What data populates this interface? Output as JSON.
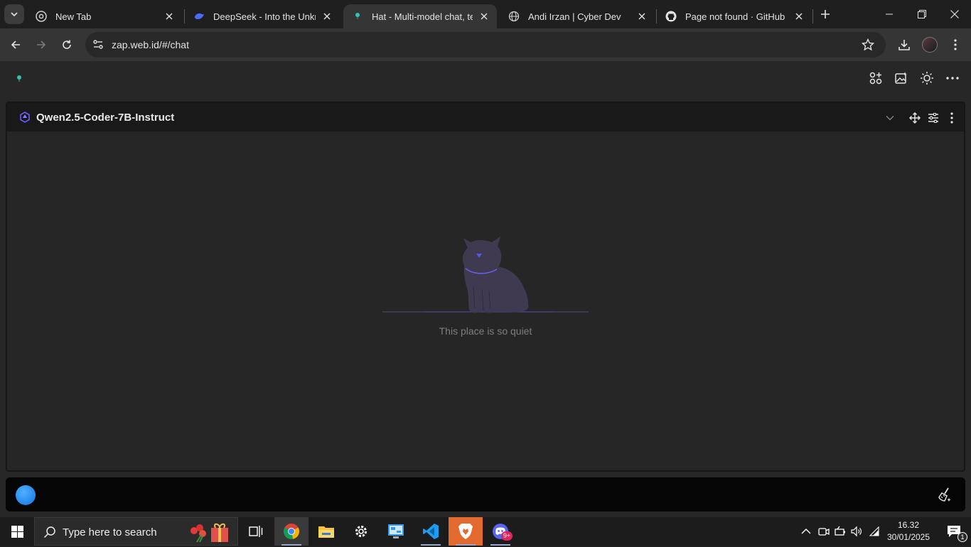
{
  "browser": {
    "tabs": [
      {
        "title": "New Tab",
        "active": false
      },
      {
        "title": "DeepSeek - Into the Unknown",
        "active": false
      },
      {
        "title": "Hat - Multi-model chat, text",
        "active": true
      },
      {
        "title": "Andi Irzan | Cyber Dev",
        "active": false
      },
      {
        "title": "Page not found · GitHub",
        "active": false
      }
    ],
    "url": "zap.web.id/#/chat"
  },
  "app": {
    "model_name": "Qwen2.5-Coder-7B-Instruct",
    "empty_state_text": "This place is so quiet",
    "colors": {
      "accent": "#5b54e8",
      "cat": "#3f3a4f",
      "send_dot": "#1e90ff"
    }
  },
  "taskbar": {
    "search_placeholder": "Type here to search",
    "time": "16.32",
    "date": "30/01/2025",
    "notification_count": "1",
    "discord_badge": "9+"
  }
}
